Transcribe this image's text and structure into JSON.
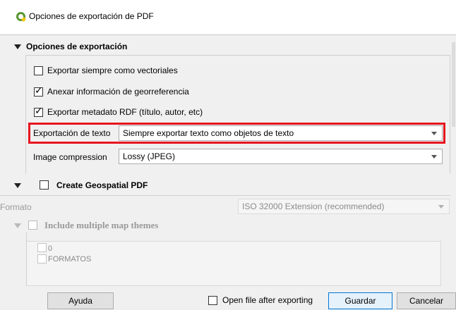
{
  "window": {
    "title": "Opciones de exportación de PDF"
  },
  "export_options": {
    "header": "Opciones de exportación",
    "always_vectors": {
      "label": "Exportar siempre como vectoriales",
      "checked": false
    },
    "georef": {
      "label": "Anexar información de georreferencia",
      "checked": true
    },
    "rdf_metadata": {
      "label": "Exportar metadato RDF (título, autor, etc)",
      "checked": true
    },
    "text_export": {
      "label": "Exportación de texto",
      "value": "Siempre exportar texto como objetos de texto"
    },
    "image_compression": {
      "label": "Image compression",
      "value": "Lossy (JPEG)"
    }
  },
  "geospatial": {
    "header": "Create Geospatial PDF",
    "checked": false,
    "format_label": "Formato",
    "format_value": "ISO 32000 Extension (recommended)",
    "map_themes": {
      "header": "Include multiple map themes",
      "checked": false,
      "items": [
        "0",
        "FORMATOS"
      ]
    }
  },
  "footer": {
    "help": "Ayuda",
    "open_after": {
      "label": "Open file after exporting",
      "checked": false
    },
    "save": "Guardar",
    "cancel": "Cancelar"
  },
  "colors": {
    "highlight": "#e8141f",
    "qgis_green": "#589632",
    "primary_button_border": "#0078d7"
  }
}
